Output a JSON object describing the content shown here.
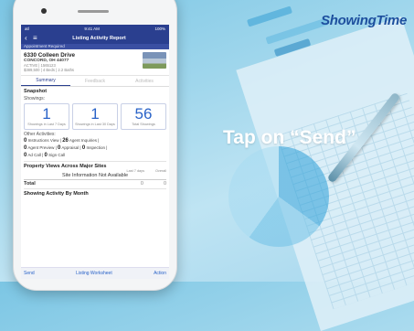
{
  "brand": "ShowingTime",
  "headline": "Tap on “Send”",
  "phone": {
    "status": {
      "carrier": "atl",
      "time": "9:41 AM",
      "battery": "100%"
    },
    "nav": {
      "back_icon": "chevron-left-icon",
      "menu_icon": "hamburger-icon",
      "title": "Listing Activity Report"
    },
    "appointment_label": "Appointment Required",
    "listing": {
      "address": "6330 Colleen Drive",
      "city": "CONCORD, OH 44077",
      "status": "ACTIVE | 1565123",
      "details": "$389,500 | 4 Beds | 2.2 Baths"
    },
    "tabs": [
      "Summary",
      "Feedback",
      "Activities"
    ],
    "snapshot": {
      "title": "Snapshot",
      "showings_label": "Showings:",
      "cards": [
        {
          "value": "1",
          "label": "Showings in Last 7 Days"
        },
        {
          "value": "1",
          "label": "Showings in Last 30 Days"
        },
        {
          "value": "56",
          "label": "Total Showings"
        }
      ]
    },
    "other": {
      "title": "Other Activities:",
      "items": [
        {
          "count": "0",
          "label": "Instructions View"
        },
        {
          "count": "26",
          "label": "Agent Inquiries"
        },
        {
          "count": "0",
          "label": "Agent Preview"
        },
        {
          "count": "0",
          "label": "Appraisal"
        },
        {
          "count": "0",
          "label": "Inspection"
        },
        {
          "count": "0",
          "label": "Ad Call"
        },
        {
          "count": "0",
          "label": "Sign Call"
        }
      ]
    },
    "views": {
      "title": "Property Views Across Major Sites",
      "col1": "Last 7 days",
      "col2": "Overall",
      "message": "Site Information Not Available",
      "total_label": "Total",
      "total_a": "0",
      "total_b": "0"
    },
    "month": {
      "title": "Showing Activity By Month"
    },
    "bottom": {
      "send": "Send",
      "worksheet": "Listing Worksheet",
      "action": "Action"
    }
  }
}
